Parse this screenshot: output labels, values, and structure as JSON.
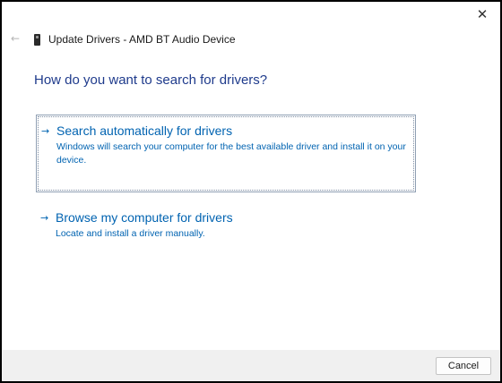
{
  "window": {
    "title": "Update Drivers - AMD BT Audio Device",
    "close_icon": "close-icon",
    "back_icon": "back-arrow-icon",
    "device_icon": "audio-device-icon"
  },
  "heading": "How do you want to search for drivers?",
  "options": [
    {
      "title": "Search automatically for drivers",
      "description": "Windows will search your computer for the best available driver and install it on your device.",
      "icon": "arrow-right-icon",
      "selected": true
    },
    {
      "title": "Browse my computer for drivers",
      "description": "Locate and install a driver manually.",
      "icon": "arrow-right-icon",
      "selected": false
    }
  ],
  "footer": {
    "cancel_label": "Cancel"
  },
  "colors": {
    "heading": "#1f3b8c",
    "link": "#0063b1",
    "footer_bg": "#f0f0f0"
  }
}
